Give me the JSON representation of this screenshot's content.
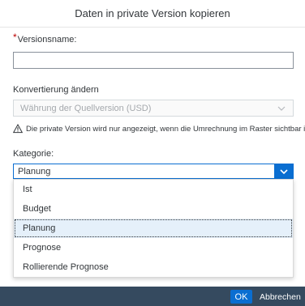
{
  "dialog": {
    "title": "Daten in private Version kopieren"
  },
  "version_name": {
    "required_marker": "*",
    "label": "Versionsname:",
    "value": ""
  },
  "conversion": {
    "label": "Konvertierung ändern",
    "selected": "Währung der Quellversion (USD)",
    "disabled": true
  },
  "warning": {
    "icon": "warning-icon",
    "text": "Die private Version wird nur angezeigt, wenn die Umrechnung im Raster sichtbar ist."
  },
  "category": {
    "label": "Kategorie:",
    "selected": "Planung",
    "options": [
      "Ist",
      "Budget",
      "Planung",
      "Prognose",
      "Rollierende Prognose"
    ],
    "highlighted_index": 2
  },
  "footer": {
    "ok_label": "OK",
    "cancel_label": "Abbrechen"
  },
  "colors": {
    "accent": "#0a6ed1",
    "footer_bg": "#354a5f",
    "required": "#bb0000"
  }
}
